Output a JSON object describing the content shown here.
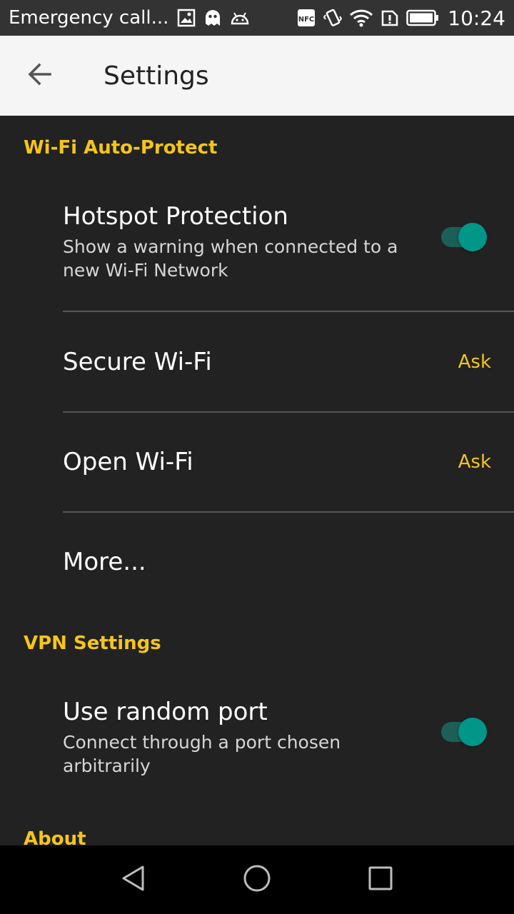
{
  "status_bar": {
    "carrier": "Emergency call...",
    "time": "10:24",
    "left_icons": [
      "image-icon",
      "ghost-icon",
      "android-icon"
    ],
    "right_icons": [
      "nfc-icon",
      "vibrate-icon",
      "wifi-icon",
      "sim-alert-icon",
      "battery-icon"
    ]
  },
  "app_bar": {
    "back_icon": "arrow-back-icon",
    "title": "Settings"
  },
  "sections": {
    "wifi": {
      "header": "Wi-Fi Auto-Protect",
      "hotspot": {
        "title": "Hotspot Protection",
        "summary": "Show a warning when connected to a new Wi-Fi Network",
        "enabled": true
      },
      "secure_wifi": {
        "title": "Secure Wi-Fi",
        "value": "Ask"
      },
      "open_wifi": {
        "title": "Open Wi-Fi",
        "value": "Ask"
      },
      "more": {
        "title": "More..."
      }
    },
    "vpn": {
      "header": "VPN Settings",
      "random_port": {
        "title": "Use random port",
        "summary": "Connect through a port chosen arbitrarily",
        "enabled": true
      }
    },
    "about": {
      "header": "About"
    }
  },
  "colors": {
    "accent": "#f5c518",
    "toggle_on": "#009688",
    "background": "#222222"
  },
  "nav_bar": {
    "icons": [
      "back-triangle-icon",
      "home-circle-icon",
      "recents-square-icon"
    ]
  }
}
